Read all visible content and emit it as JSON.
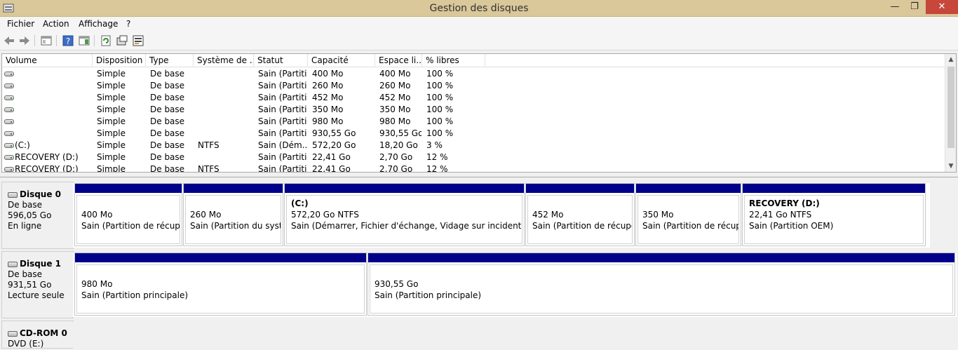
{
  "window": {
    "title": "Gestion des disques",
    "minimize": "—",
    "maximize": "❐",
    "close": "✕"
  },
  "menu": [
    "Fichier",
    "Action",
    "Affichage",
    "?"
  ],
  "toolbar_icons": [
    "back-icon",
    "forward-icon",
    "console-tree-icon",
    "help-icon",
    "action-pane-icon",
    "refresh-icon",
    "properties-icon",
    "rescan-icon"
  ],
  "columns": [
    "Volume",
    "Disposition",
    "Type",
    "Système de ...",
    "Statut",
    "Capacité",
    "Espace li...",
    "% libres"
  ],
  "rows": [
    {
      "volume": "",
      "disposition": "Simple",
      "type": "De base",
      "fs": "",
      "status": "Sain (Partiti",
      "capacity": "400 Mo",
      "free": "400 Mo",
      "pct": "100 %"
    },
    {
      "volume": "",
      "disposition": "Simple",
      "type": "De base",
      "fs": "",
      "status": "Sain (Partiti",
      "capacity": "260 Mo",
      "free": "260 Mo",
      "pct": "100 %"
    },
    {
      "volume": "",
      "disposition": "Simple",
      "type": "De base",
      "fs": "",
      "status": "Sain (Partiti",
      "capacity": "452 Mo",
      "free": "452 Mo",
      "pct": "100 %"
    },
    {
      "volume": "",
      "disposition": "Simple",
      "type": "De base",
      "fs": "",
      "status": "Sain (Partiti",
      "capacity": "350 Mo",
      "free": "350 Mo",
      "pct": "100 %"
    },
    {
      "volume": "",
      "disposition": "Simple",
      "type": "De base",
      "fs": "",
      "status": "Sain (Partiti",
      "capacity": "980 Mo",
      "free": "980 Mo",
      "pct": "100 %"
    },
    {
      "volume": "",
      "disposition": "Simple",
      "type": "De base",
      "fs": "",
      "status": "Sain (Partiti",
      "capacity": "930,55 Go",
      "free": "930,55 Go",
      "pct": "100 %"
    },
    {
      "volume": "(C:)",
      "disposition": "Simple",
      "type": "De base",
      "fs": "NTFS",
      "status": "Sain (Dém...",
      "capacity": "572,20 Go",
      "free": "18,20 Go",
      "pct": "3 %"
    },
    {
      "volume": "RECOVERY (D:)",
      "disposition": "Simple",
      "type": "De base",
      "fs": "",
      "status": "Sain (Partiti",
      "capacity": "22,41 Go",
      "free": "2,70 Go",
      "pct": "12 %"
    },
    {
      "volume": "RECOVERY (D:)",
      "disposition": "Simple",
      "type": "De base",
      "fs": "NTFS",
      "status": "Sain (Partiti",
      "capacity": "22,41 Go",
      "free": "2,70 Go",
      "pct": "12 %"
    }
  ],
  "disks": [
    {
      "name": "Disque 0",
      "type": "De base",
      "size": "596,05 Go",
      "state": "En ligne",
      "partitions": [
        {
          "name": "",
          "size": "400 Mo",
          "status": "Sain (Partition de récupéra"
        },
        {
          "name": "",
          "size": "260 Mo",
          "status": "Sain (Partition du systèm"
        },
        {
          "name": "(C:)",
          "size": "572,20 Go NTFS",
          "status": "Sain (Démarrer, Fichier d'échange, Vidage sur incident, Partitio"
        },
        {
          "name": "",
          "size": "452 Mo",
          "status": "Sain (Partition de récupérat"
        },
        {
          "name": "",
          "size": "350 Mo",
          "status": "Sain (Partition de récupéra"
        },
        {
          "name": "RECOVERY  (D:)",
          "size": "22,41 Go NTFS",
          "status": "Sain (Partition OEM)"
        }
      ]
    },
    {
      "name": "Disque 1",
      "type": "De base",
      "size": "931,51 Go",
      "state": "Lecture seule",
      "partitions": [
        {
          "name": "",
          "size": "980 Mo",
          "status": "Sain (Partition principale)"
        },
        {
          "name": "",
          "size": "930,55 Go",
          "status": "Sain (Partition principale)"
        }
      ]
    },
    {
      "name": "CD-ROM 0",
      "type": "DVD (E:)",
      "size": "",
      "state": "",
      "partitions": []
    }
  ],
  "colors": {
    "titlebar": "#dac79a",
    "partition_bar": "#00008b",
    "close": "#c7473a"
  }
}
